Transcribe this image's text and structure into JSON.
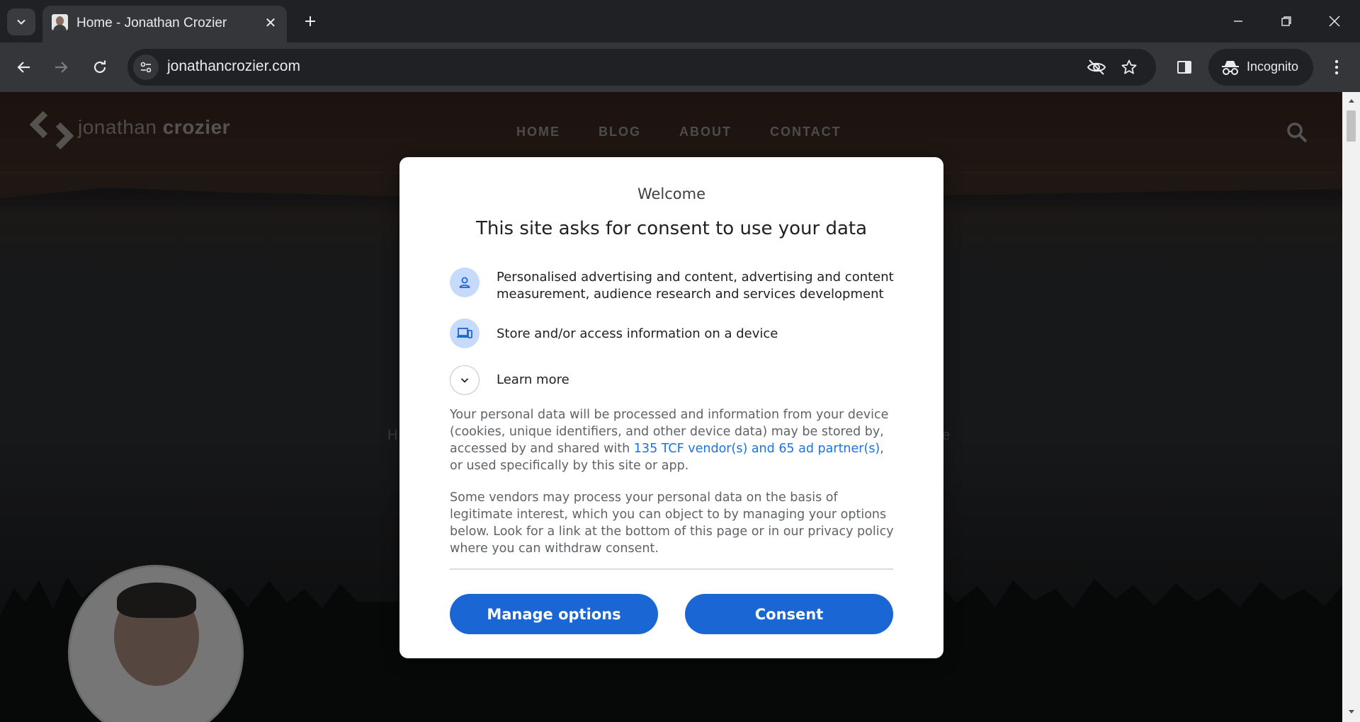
{
  "browser": {
    "tab": {
      "title": "Home - Jonathan Crozier",
      "close_glyph": "✕"
    },
    "omnibox": {
      "url": "jonathancrozier.com"
    },
    "incognito_label": "Incognito",
    "icons": {
      "tab_search": "chevron-down-icon",
      "new_tab": "plus-icon",
      "minimize": "minimize-icon",
      "restore": "restore-icon",
      "close": "close-icon",
      "back": "arrow-left-icon",
      "forward": "arrow-right-icon",
      "reload": "reload-icon",
      "site_info": "tune-icon",
      "tracking": "eye-off-icon",
      "bookmark": "star-icon",
      "side_panel": "side-panel-icon",
      "menu": "kebab-menu-icon"
    }
  },
  "site": {
    "logo": {
      "text_light": "jonathan ",
      "text_bold": "crozier"
    },
    "nav": [
      "HOME",
      "BLOG",
      "ABOUT",
      "CONTACT"
    ],
    "peek_left": "H",
    "peek_right": "e"
  },
  "dialog": {
    "welcome": "Welcome",
    "title": "This site asks for consent to use your data",
    "purposes": [
      {
        "icon": "person-icon",
        "text": "Personalised advertising and content, advertising and content measurement, audience research and services development"
      },
      {
        "icon": "devices-icon",
        "text": "Store and/or access information on a device"
      }
    ],
    "learn_more": "Learn more",
    "paragraph1_before": "Your personal data will be processed and information from your device (cookies, unique identifiers, and other device data) may be stored by, accessed by and shared with ",
    "paragraph1_link": "135 TCF vendor(s) and 65 ad partner(s)",
    "paragraph1_after": ", or used specifically by this site or app.",
    "paragraph2": "Some vendors may process your personal data on the basis of legitimate interest, which you can object to by managing your options below. Look for a link at the bottom of this page or in our privacy policy where you can withdraw consent.",
    "buttons": {
      "manage": "Manage options",
      "consent": "Consent"
    }
  },
  "colors": {
    "chrome_dark": "#202124",
    "chrome_toolbar": "#35363a",
    "accent_blue": "#1a66d4",
    "link_blue": "#1a73e8",
    "icon_bg": "#c6dafc"
  }
}
